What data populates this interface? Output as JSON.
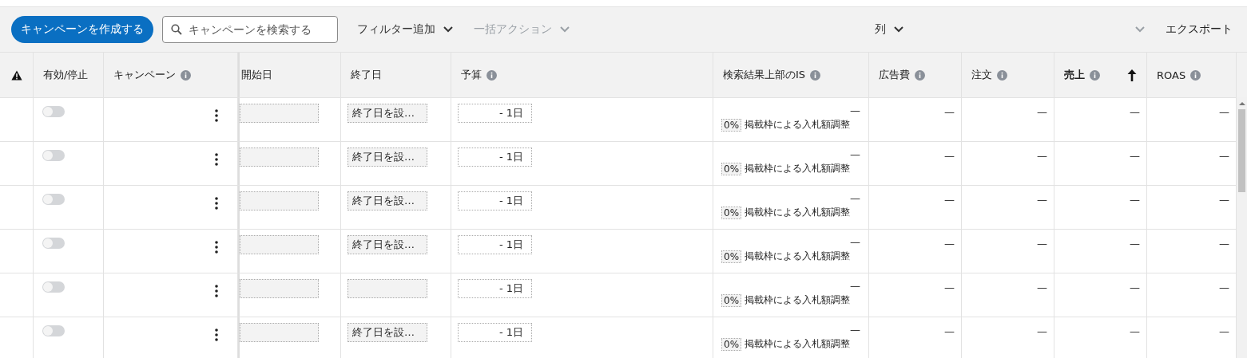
{
  "toolbar": {
    "create_button": "キャンペーンを作成する",
    "search": {
      "placeholder": "キャンペーンを検索する"
    },
    "dropdowns": [
      {
        "label": "フィルター追加",
        "disabled": false
      },
      {
        "label": "一括アクション",
        "disabled": true
      }
    ],
    "columns_menu": "列",
    "blank_dropdown": {
      "disabled": true
    },
    "export_button": "エクスポート"
  },
  "table": {
    "columns": [
      {
        "kind": "warning"
      },
      {
        "kind": "text",
        "label": "有効/停止",
        "info": false,
        "sorted": false
      },
      {
        "kind": "text",
        "label": "キャンペーン",
        "info": true,
        "sorted": false
      },
      {
        "kind": "text",
        "label": "開始日",
        "info": false,
        "sorted": false
      },
      {
        "kind": "text",
        "label": "終了日",
        "info": false,
        "sorted": false
      },
      {
        "kind": "text",
        "label": "予算",
        "info": true,
        "sorted": false
      },
      {
        "kind": "text",
        "label": "検索結果上部のIS",
        "info": true,
        "sorted": false
      },
      {
        "kind": "text",
        "label": "広告費",
        "info": true,
        "sorted": false
      },
      {
        "kind": "text",
        "label": "注文",
        "info": true,
        "sorted": false
      },
      {
        "kind": "text",
        "label": "売上",
        "info": true,
        "sorted": true
      },
      {
        "kind": "text",
        "label": "ROAS",
        "info": true,
        "sorted": false
      }
    ],
    "rows": [
      {
        "on": false,
        "end_date": "終了日を設…",
        "budget": "- 1日",
        "is_value": "—",
        "bid_adjust": "0%",
        "bid_label": "掲載枠による入札額調整",
        "ad_spend": "—",
        "orders": "—",
        "sales": "—",
        "roas": "—"
      },
      {
        "on": false,
        "end_date": "終了日を設…",
        "budget": "- 1日",
        "is_value": "—",
        "bid_adjust": "0%",
        "bid_label": "掲載枠による入札額調整",
        "ad_spend": "—",
        "orders": "—",
        "sales": "—",
        "roas": "—"
      },
      {
        "on": false,
        "end_date": "終了日を設…",
        "budget": "- 1日",
        "is_value": "—",
        "bid_adjust": "0%",
        "bid_label": "掲載枠による入札額調整",
        "ad_spend": "—",
        "orders": "—",
        "sales": "—",
        "roas": "—"
      },
      {
        "on": false,
        "end_date": "終了日を設…",
        "budget": "- 1日",
        "is_value": "—",
        "bid_adjust": "0%",
        "bid_label": "掲載枠による入札額調整",
        "ad_spend": "—",
        "orders": "—",
        "sales": "—",
        "roas": "—"
      },
      {
        "on": false,
        "budget": "- 1日",
        "is_value": "—",
        "bid_adjust": "0%",
        "bid_label": "掲載枠による入札額調整",
        "ad_spend": "—",
        "orders": "—",
        "sales": "—",
        "roas": "—"
      },
      {
        "on": false,
        "end_date": "終了日を設…",
        "budget": "- 1日",
        "is_value": "—",
        "bid_adjust": "0%",
        "bid_label": "掲載枠による入札額調整",
        "ad_spend": "—",
        "orders": "—",
        "sales": "—",
        "roas": "—"
      }
    ]
  }
}
